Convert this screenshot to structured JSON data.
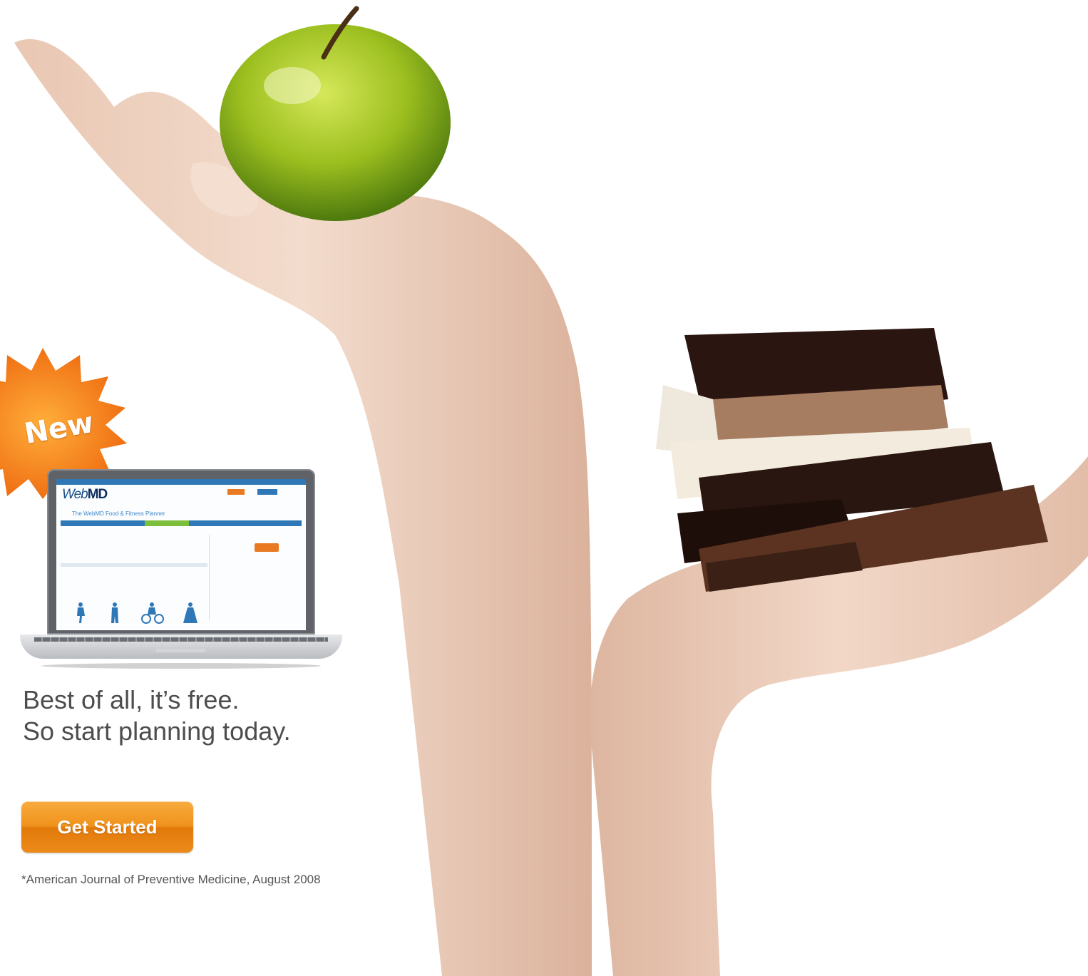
{
  "badge": {
    "text": "New"
  },
  "laptop_screen": {
    "logo_prefix": "Web",
    "logo_suffix": "MD",
    "planner_title": "The WebMD Food & Fitness Planner"
  },
  "promo": {
    "line1": "Best of all, it’s free.",
    "line2": "So start planning today."
  },
  "cta": {
    "label": "Get Started"
  },
  "footnote": "*American Journal of Preventive Medicine, August 2008",
  "colors": {
    "accent_orange": "#f0921c",
    "brand_blue": "#2f78b8",
    "text_gray": "#4d4d4d"
  },
  "icons": [
    "starburst-badge",
    "apple",
    "chocolate-stack",
    "fitness-figures"
  ]
}
